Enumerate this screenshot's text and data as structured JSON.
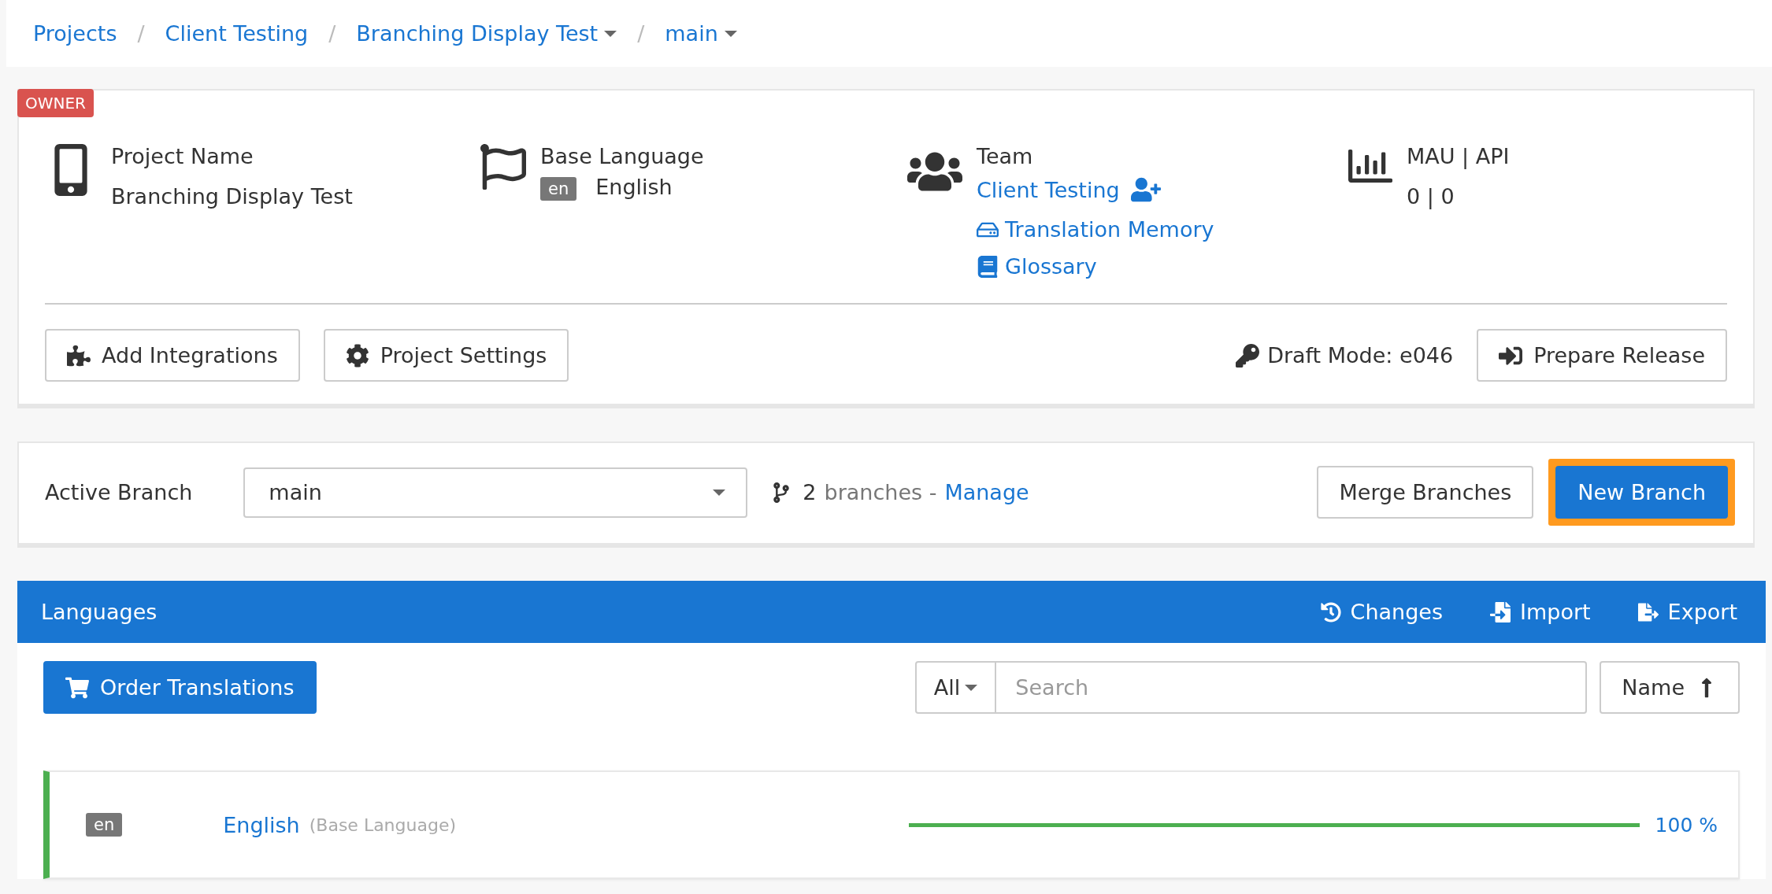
{
  "breadcrumb_separator": "/",
  "breadcrumb": [
    {
      "label": "Projects",
      "dropdown": false
    },
    {
      "label": "Client Testing",
      "dropdown": false
    },
    {
      "label": "Branching Display Test",
      "dropdown": true
    },
    {
      "label": "main",
      "dropdown": true
    }
  ],
  "project": {
    "badge": "OWNER",
    "name": {
      "label": "Project Name",
      "value": "Branching Display Test"
    },
    "base_language": {
      "label": "Base Language",
      "code": "en",
      "name": "English"
    },
    "team": {
      "label": "Team",
      "name": "Client Testing",
      "links": [
        {
          "kind": "memory",
          "label": "Translation Memory"
        },
        {
          "kind": "glossary",
          "label": "Glossary"
        }
      ]
    },
    "usage": {
      "label": "MAU | API",
      "value": "0 | 0"
    },
    "actions": [
      {
        "kind": "integrations",
        "label": "Add Integrations"
      },
      {
        "kind": "settings",
        "label": "Project Settings"
      }
    ],
    "draft": "Draft Mode: e046",
    "release": {
      "label": "Prepare Release"
    }
  },
  "branch": {
    "label": "Active Branch",
    "value": "main",
    "count": "2",
    "count_text": "branches -",
    "link": "Manage",
    "buttons": [
      {
        "kind": "default",
        "label": "Merge Branches",
        "highlighted": false
      },
      {
        "kind": "primary",
        "label": "New Branch",
        "highlighted": true
      }
    ]
  },
  "languages": {
    "title": "Languages",
    "actions": [
      {
        "kind": "history",
        "label": "Changes"
      },
      {
        "kind": "import",
        "label": "Import"
      },
      {
        "kind": "export",
        "label": "Export"
      }
    ],
    "order": "Order Translations",
    "filter": "All",
    "search": {
      "placeholder": "Search"
    },
    "sort": "Name",
    "rows": [
      {
        "code": "en",
        "name": "English",
        "note": "(Base Language)",
        "level": 1,
        "reading": "100 %"
      }
    ]
  }
}
